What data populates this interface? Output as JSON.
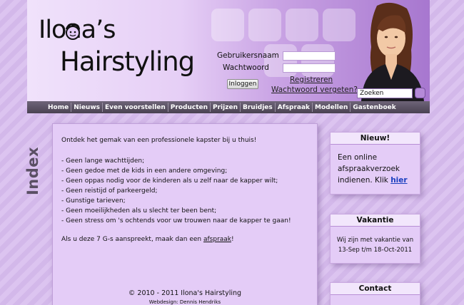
{
  "header": {
    "logo_line1": "Ilona’s",
    "logo_line2": "Hairstyling",
    "username_label": "Gebruikersnaam",
    "password_label": "Wachtwoord",
    "login_button": "Inloggen",
    "register_link": "Registreren",
    "forgot_link": "Wachtwoord vergeten?",
    "search_placeholder": "Zoeken"
  },
  "nav": {
    "items": [
      "Home",
      "Nieuws",
      "Even voorstellen",
      "Producten",
      "Prijzen",
      "Bruidjes",
      "Afspraak",
      "Modellen",
      "Gastenboek"
    ]
  },
  "sidebar_label": "Index",
  "content": {
    "intro": "Ontdek het gemak van een professionele kapster bij u thuis!",
    "bullets": [
      "- Geen lange wachttijden;",
      "- Geen gedoe met de kids in een andere omgeving;",
      "- Geen oppas nodig voor de kinderen als u zelf naar de kapper wilt;",
      "- Geen reistijd of parkeergeld;",
      "- Gunstige tarieven;",
      "- Geen moeilijkheden als u slecht ter been bent;",
      "- Geen stress om 's ochtends voor uw trouwen naar de kapper te gaan!"
    ],
    "closing_text": "Als u deze 7 G-s aanspreekt, maak dan een ",
    "closing_link": "afspraak",
    "closing_end": "!"
  },
  "footer": {
    "copyright": "© 2010 - 2011 Ilona's Hairstyling",
    "design": "Webdesign: Dennis Hendriks"
  },
  "sidebox_new": {
    "title": "Nieuw!",
    "line1": "Een online",
    "line2": "afspraakverzoek",
    "line3_text": "indienen. Klik ",
    "line3_link": "hier"
  },
  "sidebox_vacation": {
    "title": "Vakantie",
    "line1": "Wij zijn met vakantie van",
    "line2": "13-Sep t/m 18-Oct-2011"
  },
  "sidebox_contact": {
    "title": "Contact"
  },
  "colors": {
    "page_bg": "#d9c2ee",
    "nav_bg": "#4a4252",
    "content_bg": "#e4ccf7",
    "link_blue": "#1a3fbf"
  }
}
